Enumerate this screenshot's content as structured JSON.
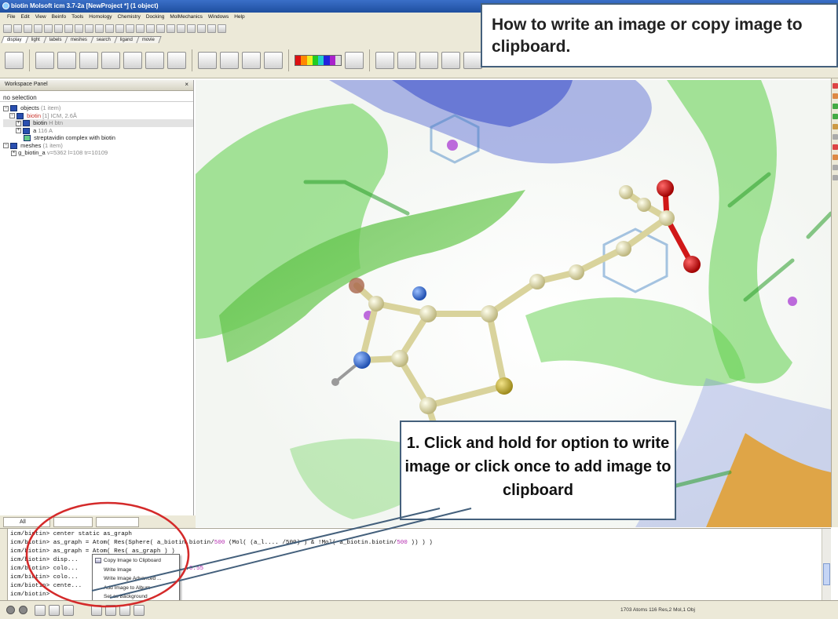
{
  "window": {
    "title": "biotin Molsoft icm 3.7-2a [NewProject *] (1 object)"
  },
  "menu": [
    "File",
    "Edit",
    "View",
    "Beinfo",
    "Tools",
    "Homology",
    "Chemistry",
    "Docking",
    "MolMechanics",
    "Windows",
    "Help"
  ],
  "tabs": [
    "display",
    "light",
    "labels",
    "meshes",
    "search",
    "ligand",
    "movie"
  ],
  "workspace": {
    "title": "Workspace Panel",
    "controls": "×",
    "selection": "no selection",
    "tree": [
      {
        "label": "objects",
        "detail": "(1 item)"
      },
      {
        "label": "biotin",
        "detail": "[1] ICM, 2.6Å"
      },
      {
        "label": "biotin",
        "detail": "H btn"
      },
      {
        "label": "a",
        "detail": "116 A"
      },
      {
        "label": "streptavidin complex with biotin",
        "detail": ""
      },
      {
        "label": "meshes",
        "detail": "(1 item)"
      },
      {
        "label": "g_biotin_a",
        "detail": "v=5362 l=108 tr=10109"
      }
    ]
  },
  "terminal": {
    "tab_label": "All",
    "lines": [
      {
        "prompt": "icm/biotin>",
        "cmd": " center static as_graph"
      },
      {
        "prompt": "icm/biotin>",
        "cmd": " as_graph = Atom( Res(Sphere( a_biotin.biotin/",
        "hl": "500",
        "rest": " (Mol( (a_l.... /500) ) & !Mol( a_biotin.biotin/",
        "hl2": "500",
        "rest2": " )) ) )"
      },
      {
        "prompt": "icm/biotin>",
        "cmd": " as_graph = Atom( Res( as_graph ) )"
      },
      {
        "prompt": "icm/biotin>",
        "cmd": " disp..."
      },
      {
        "prompt": "icm/biotin>",
        "cmd": " colo...                  ( a_//cd ....",
        "hl": "0.55"
      },
      {
        "prompt": "icm/biotin>",
        "cmd": " colo..."
      },
      {
        "prompt": "icm/biotin>",
        "cmd": " cente..."
      },
      {
        "prompt": "icm/biotin>",
        "cmd": " "
      }
    ]
  },
  "context_menu": {
    "items": [
      "Copy Image to Clipboard",
      "Write Image",
      "Write Image Advanced ...",
      "Add Image to Album",
      "Set as Background"
    ]
  },
  "status": {
    "text": "1703 Atoms 116 Res,2 Mol,1 Obj"
  },
  "callouts": {
    "top": "How to write an image or copy image to clipboard.",
    "bottom": "1. Click and hold for option to write image or click once to add image to clipboard"
  },
  "colors": {
    "callout_border": "#44607c",
    "annotation_circle": "#d42a2a",
    "molecule_carbon": "#e8e3b0",
    "oxygen": "#d01818",
    "nitrogen": "#3a6fd8",
    "sulfur": "#c9b640",
    "surface_green": "#5fcf4a"
  }
}
